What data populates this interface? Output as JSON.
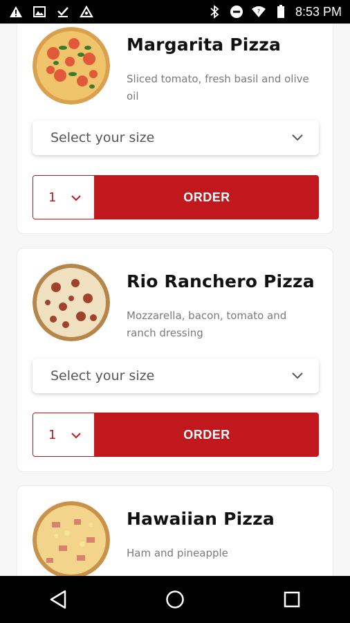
{
  "status_bar": {
    "time": "8:53 PM"
  },
  "select_placeholder": "Select your size",
  "products": [
    {
      "name": "Margarita Pizza",
      "desc_line1": "Sliced tomato, fresh basil and olive",
      "desc_line2": "oil",
      "qty": "1",
      "order_label": "ORDER"
    },
    {
      "name": "Rio Ranchero Pizza",
      "desc_line1": "Mozzarella, bacon, tomato and",
      "desc_line2": "ranch dressing",
      "qty": "1",
      "order_label": "ORDER"
    },
    {
      "name": "Hawaiian Pizza",
      "desc_line1": "Ham and pineapple",
      "desc_line2": ""
    }
  ],
  "colors": {
    "accent": "#c0181c",
    "text": "#111111",
    "muted": "#7a7a7a"
  }
}
